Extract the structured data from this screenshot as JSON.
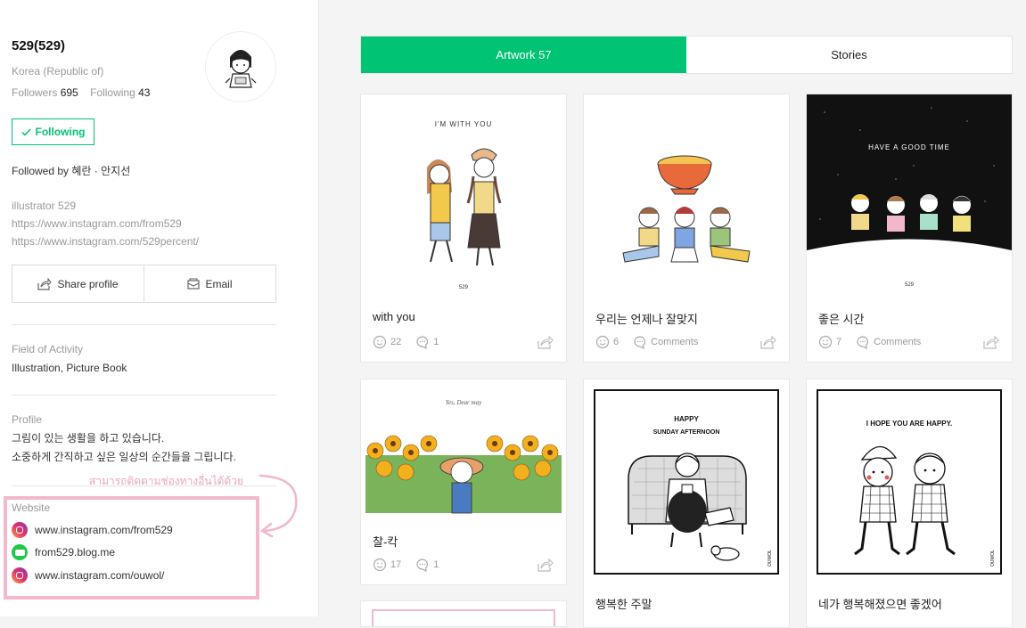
{
  "profile": {
    "name": "529(529)",
    "country": "Korea (Republic of)",
    "followers_label": "Followers",
    "followers_count": "695",
    "following_label": "Following",
    "following_count": "43",
    "following_button": "Following",
    "followed_by_label": "Followed by",
    "followed_by_names": "혜란 · 안지선",
    "bio": [
      "illustrator 529",
      "https://www.instagram.com/from529",
      "https://www.instagram.com/529percent/"
    ],
    "share_label": "Share profile",
    "email_label": "Email",
    "field_label": "Field of Activity",
    "field_value": "Illustration, Picture Book",
    "profile_label": "Profile",
    "profile_text": [
      "그림이 있는 생활을 하고 있습니다.",
      "소중하게 간직하고 싶은 일상의 순간들을 그립니다."
    ],
    "website_label": "Website",
    "websites": [
      "www.instagram.com/from529",
      "from529.blog.me",
      "www.instagram.com/ouwol/"
    ]
  },
  "annotation": {
    "text": "สามารถติดตามช่องทางอื่นได้ด้วย",
    "color": "#e9a5bd"
  },
  "tabs": [
    "Artwork 57",
    "Stories"
  ],
  "accent_color": "#00c473",
  "cards": [
    {
      "title": "with you",
      "likes": "22",
      "comments": "1",
      "art_text": "I'M WITH YOU",
      "signature": "529"
    },
    {
      "title": "우리는 언제나 잘맞지",
      "likes": "6",
      "comments": "Comments"
    },
    {
      "title": "좋은 시간",
      "likes": "7",
      "comments": "Comments",
      "art_text": "HAVE A GOOD TIME",
      "signature": "529"
    },
    {
      "title": "찰-칵",
      "likes": "17",
      "comments": "1",
      "art_text": "Yes, Dear may"
    },
    {
      "title": "행복한 주말",
      "art_text": [
        "HAPPY",
        "SUNDAY AFTERNOON"
      ],
      "signature": "OUWOL"
    },
    {
      "title": "네가 행복해졌으면 좋겠어",
      "art_text": "I HOPE YOU ARE HAPPY.",
      "signature": "OUWOL"
    }
  ]
}
